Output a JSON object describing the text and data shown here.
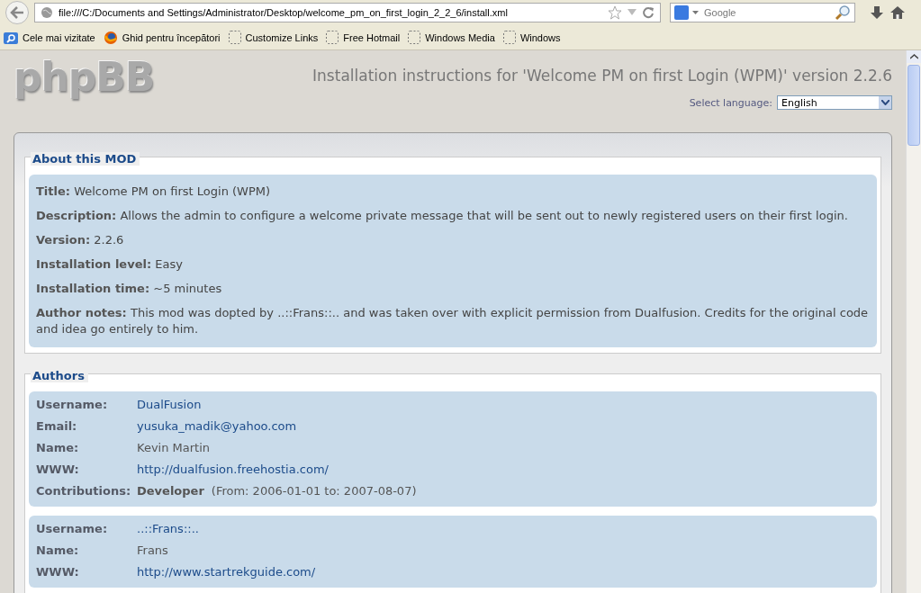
{
  "browser": {
    "url": "file:///C:/Documents and Settings/Administrator/Desktop/welcome_pm_on_first_login_2_2_6/install.xml",
    "search_placeholder": "Google",
    "bookmarks": [
      {
        "label": "Cele mai vizitate",
        "kind": "search"
      },
      {
        "label": "Ghid pentru începători",
        "kind": "firefox"
      },
      {
        "label": "Customize Links",
        "kind": "blank"
      },
      {
        "label": "Free Hotmail",
        "kind": "blank"
      },
      {
        "label": "Windows Media",
        "kind": "blank"
      },
      {
        "label": "Windows",
        "kind": "blank"
      }
    ]
  },
  "page": {
    "logo": "phpBB",
    "title": "Installation instructions for 'Welcome PM on first Login (WPM)' version 2.2.6",
    "language_label": "Select language:",
    "language": "English",
    "about": {
      "heading": "About this MOD",
      "fields": [
        {
          "label": "Title:",
          "value": "Welcome PM on first Login (WPM)"
        },
        {
          "label": "Description:",
          "value": "Allows the admin to configure a welcome private message that will be sent out to newly registered users on their first login."
        },
        {
          "label": "Version:",
          "value": "2.2.6"
        },
        {
          "label": "Installation level:",
          "value": "Easy"
        },
        {
          "label": "Installation time:",
          "value": "~5 minutes"
        },
        {
          "label": "Author notes:",
          "value": "This mod was dopted by ..::Frans::.. and was taken over with explicit permission from Dualfusion. Credits for the original code and idea go entirely to him."
        }
      ]
    },
    "authors": {
      "heading": "Authors",
      "cards": [
        {
          "fields": [
            {
              "label": "Username:",
              "value": "DualFusion",
              "kind": "link"
            },
            {
              "label": "Email:",
              "value": "yusuka_madik@yahoo.com",
              "kind": "link"
            },
            {
              "label": "Name:",
              "value": "Kevin Martin",
              "kind": "text"
            },
            {
              "label": "WWW:",
              "value": "http://dualfusion.freehostia.com/",
              "kind": "link"
            },
            {
              "label": "Contributions:",
              "value": "Developer",
              "note": "(From: 2006-01-01 to: 2007-08-07)",
              "kind": "contribution"
            }
          ]
        },
        {
          "fields": [
            {
              "label": "Username:",
              "value": "..::Frans::..",
              "kind": "link"
            },
            {
              "label": "Name:",
              "value": "Frans",
              "kind": "text"
            },
            {
              "label": "WWW:",
              "value": "http://www.startrekguide.com/",
              "kind": "link"
            }
          ]
        }
      ]
    }
  }
}
